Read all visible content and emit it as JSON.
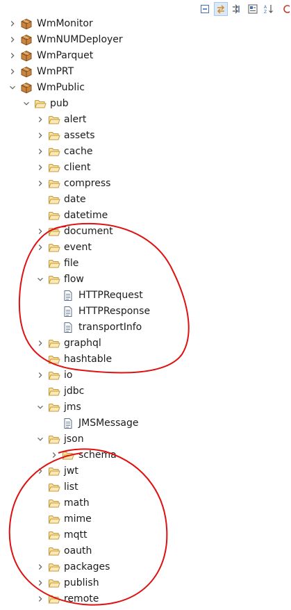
{
  "toolbar": {
    "buttons": [
      {
        "icon": "collapse-all-icon"
      },
      {
        "icon": "link-with-editor-icon",
        "active": true
      },
      {
        "icon": "filter-icon"
      },
      {
        "icon": "view-menu-icon"
      },
      {
        "icon": "sort-alpha-icon"
      },
      {
        "icon": "partial-icon"
      }
    ]
  },
  "tree": {
    "items": [
      {
        "label": "WmMonitor",
        "depth": 0,
        "type": "package",
        "expander": "collapsed"
      },
      {
        "label": "WmNUMDeployer",
        "depth": 0,
        "type": "package",
        "expander": "collapsed"
      },
      {
        "label": "WmParquet",
        "depth": 0,
        "type": "package",
        "expander": "collapsed"
      },
      {
        "label": "WmPRT",
        "depth": 0,
        "type": "package",
        "expander": "collapsed"
      },
      {
        "label": "WmPublic",
        "depth": 0,
        "type": "package",
        "expander": "expanded"
      },
      {
        "label": "pub",
        "depth": 1,
        "type": "folder",
        "expander": "expanded"
      },
      {
        "label": "alert",
        "depth": 2,
        "type": "folder",
        "expander": "collapsed"
      },
      {
        "label": "assets",
        "depth": 2,
        "type": "folder",
        "expander": "collapsed"
      },
      {
        "label": "cache",
        "depth": 2,
        "type": "folder",
        "expander": "collapsed"
      },
      {
        "label": "client",
        "depth": 2,
        "type": "folder",
        "expander": "collapsed"
      },
      {
        "label": "compress",
        "depth": 2,
        "type": "folder",
        "expander": "collapsed"
      },
      {
        "label": "date",
        "depth": 2,
        "type": "folder",
        "expander": "none"
      },
      {
        "label": "datetime",
        "depth": 2,
        "type": "folder",
        "expander": "none"
      },
      {
        "label": "document",
        "depth": 2,
        "type": "folder",
        "expander": "collapsed"
      },
      {
        "label": "event",
        "depth": 2,
        "type": "folder",
        "expander": "collapsed"
      },
      {
        "label": "file",
        "depth": 2,
        "type": "folder",
        "expander": "none"
      },
      {
        "label": "flow",
        "depth": 2,
        "type": "folder",
        "expander": "expanded"
      },
      {
        "label": "HTTPRequest",
        "depth": 3,
        "type": "doc",
        "expander": "none"
      },
      {
        "label": "HTTPResponse",
        "depth": 3,
        "type": "doc",
        "expander": "none"
      },
      {
        "label": "transportInfo",
        "depth": 3,
        "type": "doc",
        "expander": "none"
      },
      {
        "label": "graphql",
        "depth": 2,
        "type": "folder",
        "expander": "collapsed"
      },
      {
        "label": "hashtable",
        "depth": 2,
        "type": "folder",
        "expander": "none"
      },
      {
        "label": "io",
        "depth": 2,
        "type": "folder",
        "expander": "collapsed"
      },
      {
        "label": "jdbc",
        "depth": 2,
        "type": "folder",
        "expander": "none"
      },
      {
        "label": "jms",
        "depth": 2,
        "type": "folder",
        "expander": "expanded"
      },
      {
        "label": "JMSMessage",
        "depth": 3,
        "type": "doc",
        "expander": "none"
      },
      {
        "label": "json",
        "depth": 2,
        "type": "folder",
        "expander": "expanded"
      },
      {
        "label": "schema",
        "depth": 3,
        "type": "folder",
        "expander": "collapsed"
      },
      {
        "label": "jwt",
        "depth": 2,
        "type": "folder",
        "expander": "collapsed"
      },
      {
        "label": "list",
        "depth": 2,
        "type": "folder",
        "expander": "none"
      },
      {
        "label": "math",
        "depth": 2,
        "type": "folder",
        "expander": "none"
      },
      {
        "label": "mime",
        "depth": 2,
        "type": "folder",
        "expander": "none"
      },
      {
        "label": "mqtt",
        "depth": 2,
        "type": "folder",
        "expander": "none"
      },
      {
        "label": "oauth",
        "depth": 2,
        "type": "folder",
        "expander": "none"
      },
      {
        "label": "packages",
        "depth": 2,
        "type": "folder",
        "expander": "collapsed"
      },
      {
        "label": "publish",
        "depth": 2,
        "type": "folder",
        "expander": "collapsed"
      },
      {
        "label": "remote",
        "depth": 2,
        "type": "folder",
        "expander": "collapsed"
      }
    ]
  },
  "colors": {
    "annotation": "#e01010",
    "folder_fill": "#f7dfa0",
    "folder_stroke": "#c49a3c",
    "package_fill": "#c9853f",
    "twistie": "#6b6b6b"
  }
}
